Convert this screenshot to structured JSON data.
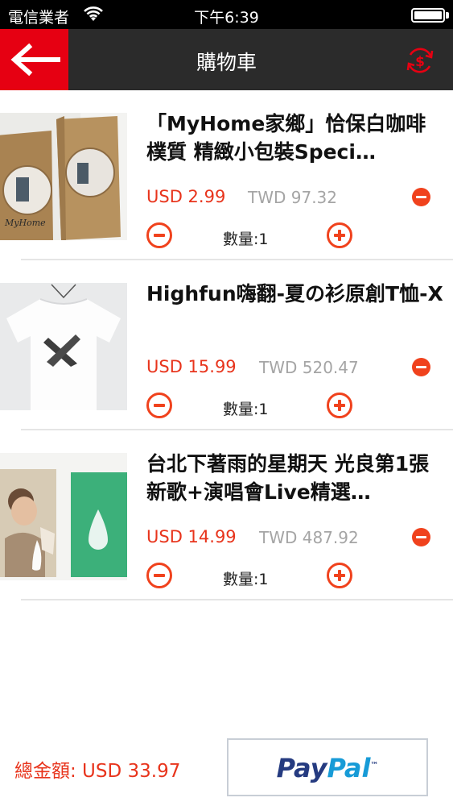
{
  "status_bar": {
    "carrier": "電信業者",
    "time": "下午6:39"
  },
  "nav": {
    "title": "購物車"
  },
  "items": [
    {
      "title": "「MyHome家鄉」恰保白咖啡 樸質 精緻小包裝Speci…",
      "price_usd": "USD 2.99",
      "price_twd": "TWD 97.32",
      "quantity": "數量:1",
      "image": "coffee-bags-product-photo"
    },
    {
      "title": "Highfun嗨翻-夏の衫原創T恤-X",
      "price_usd": "USD 15.99",
      "price_twd": "TWD 520.47",
      "quantity": "數量:1",
      "image": "white-tshirt-product-photo"
    },
    {
      "title": "台北下著雨的星期天 光良第1張新歌+演唱會Live精選…",
      "price_usd": "USD 14.99",
      "price_twd": "TWD 487.92",
      "quantity": "數量:1",
      "image": "album-cd-product-photo"
    }
  ],
  "footer": {
    "total": "總金額: USD 33.97",
    "paypal_pay": "Pay",
    "paypal_pal": "Pal",
    "paypal_tm": "™"
  },
  "colors": {
    "accent": "#e60012",
    "price": "#e8341c",
    "navbar": "#2b2b2b"
  }
}
